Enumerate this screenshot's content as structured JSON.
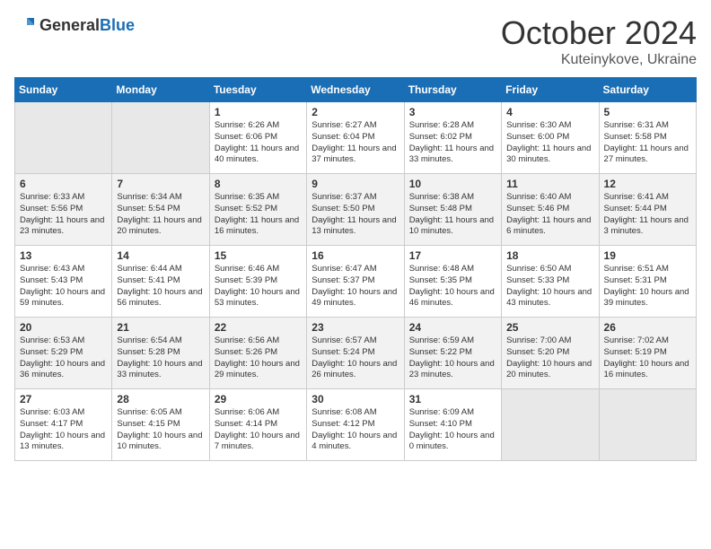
{
  "logo": {
    "general": "General",
    "blue": "Blue"
  },
  "title": "October 2024",
  "location": "Kuteinykove, Ukraine",
  "days_of_week": [
    "Sunday",
    "Monday",
    "Tuesday",
    "Wednesday",
    "Thursday",
    "Friday",
    "Saturday"
  ],
  "weeks": [
    [
      {
        "day": "",
        "info": ""
      },
      {
        "day": "",
        "info": ""
      },
      {
        "day": "1",
        "info": "Sunrise: 6:26 AM\nSunset: 6:06 PM\nDaylight: 11 hours and 40 minutes."
      },
      {
        "day": "2",
        "info": "Sunrise: 6:27 AM\nSunset: 6:04 PM\nDaylight: 11 hours and 37 minutes."
      },
      {
        "day": "3",
        "info": "Sunrise: 6:28 AM\nSunset: 6:02 PM\nDaylight: 11 hours and 33 minutes."
      },
      {
        "day": "4",
        "info": "Sunrise: 6:30 AM\nSunset: 6:00 PM\nDaylight: 11 hours and 30 minutes."
      },
      {
        "day": "5",
        "info": "Sunrise: 6:31 AM\nSunset: 5:58 PM\nDaylight: 11 hours and 27 minutes."
      }
    ],
    [
      {
        "day": "6",
        "info": "Sunrise: 6:33 AM\nSunset: 5:56 PM\nDaylight: 11 hours and 23 minutes."
      },
      {
        "day": "7",
        "info": "Sunrise: 6:34 AM\nSunset: 5:54 PM\nDaylight: 11 hours and 20 minutes."
      },
      {
        "day": "8",
        "info": "Sunrise: 6:35 AM\nSunset: 5:52 PM\nDaylight: 11 hours and 16 minutes."
      },
      {
        "day": "9",
        "info": "Sunrise: 6:37 AM\nSunset: 5:50 PM\nDaylight: 11 hours and 13 minutes."
      },
      {
        "day": "10",
        "info": "Sunrise: 6:38 AM\nSunset: 5:48 PM\nDaylight: 11 hours and 10 minutes."
      },
      {
        "day": "11",
        "info": "Sunrise: 6:40 AM\nSunset: 5:46 PM\nDaylight: 11 hours and 6 minutes."
      },
      {
        "day": "12",
        "info": "Sunrise: 6:41 AM\nSunset: 5:44 PM\nDaylight: 11 hours and 3 minutes."
      }
    ],
    [
      {
        "day": "13",
        "info": "Sunrise: 6:43 AM\nSunset: 5:43 PM\nDaylight: 10 hours and 59 minutes."
      },
      {
        "day": "14",
        "info": "Sunrise: 6:44 AM\nSunset: 5:41 PM\nDaylight: 10 hours and 56 minutes."
      },
      {
        "day": "15",
        "info": "Sunrise: 6:46 AM\nSunset: 5:39 PM\nDaylight: 10 hours and 53 minutes."
      },
      {
        "day": "16",
        "info": "Sunrise: 6:47 AM\nSunset: 5:37 PM\nDaylight: 10 hours and 49 minutes."
      },
      {
        "day": "17",
        "info": "Sunrise: 6:48 AM\nSunset: 5:35 PM\nDaylight: 10 hours and 46 minutes."
      },
      {
        "day": "18",
        "info": "Sunrise: 6:50 AM\nSunset: 5:33 PM\nDaylight: 10 hours and 43 minutes."
      },
      {
        "day": "19",
        "info": "Sunrise: 6:51 AM\nSunset: 5:31 PM\nDaylight: 10 hours and 39 minutes."
      }
    ],
    [
      {
        "day": "20",
        "info": "Sunrise: 6:53 AM\nSunset: 5:29 PM\nDaylight: 10 hours and 36 minutes."
      },
      {
        "day": "21",
        "info": "Sunrise: 6:54 AM\nSunset: 5:28 PM\nDaylight: 10 hours and 33 minutes."
      },
      {
        "day": "22",
        "info": "Sunrise: 6:56 AM\nSunset: 5:26 PM\nDaylight: 10 hours and 29 minutes."
      },
      {
        "day": "23",
        "info": "Sunrise: 6:57 AM\nSunset: 5:24 PM\nDaylight: 10 hours and 26 minutes."
      },
      {
        "day": "24",
        "info": "Sunrise: 6:59 AM\nSunset: 5:22 PM\nDaylight: 10 hours and 23 minutes."
      },
      {
        "day": "25",
        "info": "Sunrise: 7:00 AM\nSunset: 5:20 PM\nDaylight: 10 hours and 20 minutes."
      },
      {
        "day": "26",
        "info": "Sunrise: 7:02 AM\nSunset: 5:19 PM\nDaylight: 10 hours and 16 minutes."
      }
    ],
    [
      {
        "day": "27",
        "info": "Sunrise: 6:03 AM\nSunset: 4:17 PM\nDaylight: 10 hours and 13 minutes."
      },
      {
        "day": "28",
        "info": "Sunrise: 6:05 AM\nSunset: 4:15 PM\nDaylight: 10 hours and 10 minutes."
      },
      {
        "day": "29",
        "info": "Sunrise: 6:06 AM\nSunset: 4:14 PM\nDaylight: 10 hours and 7 minutes."
      },
      {
        "day": "30",
        "info": "Sunrise: 6:08 AM\nSunset: 4:12 PM\nDaylight: 10 hours and 4 minutes."
      },
      {
        "day": "31",
        "info": "Sunrise: 6:09 AM\nSunset: 4:10 PM\nDaylight: 10 hours and 0 minutes."
      },
      {
        "day": "",
        "info": ""
      },
      {
        "day": "",
        "info": ""
      }
    ]
  ]
}
